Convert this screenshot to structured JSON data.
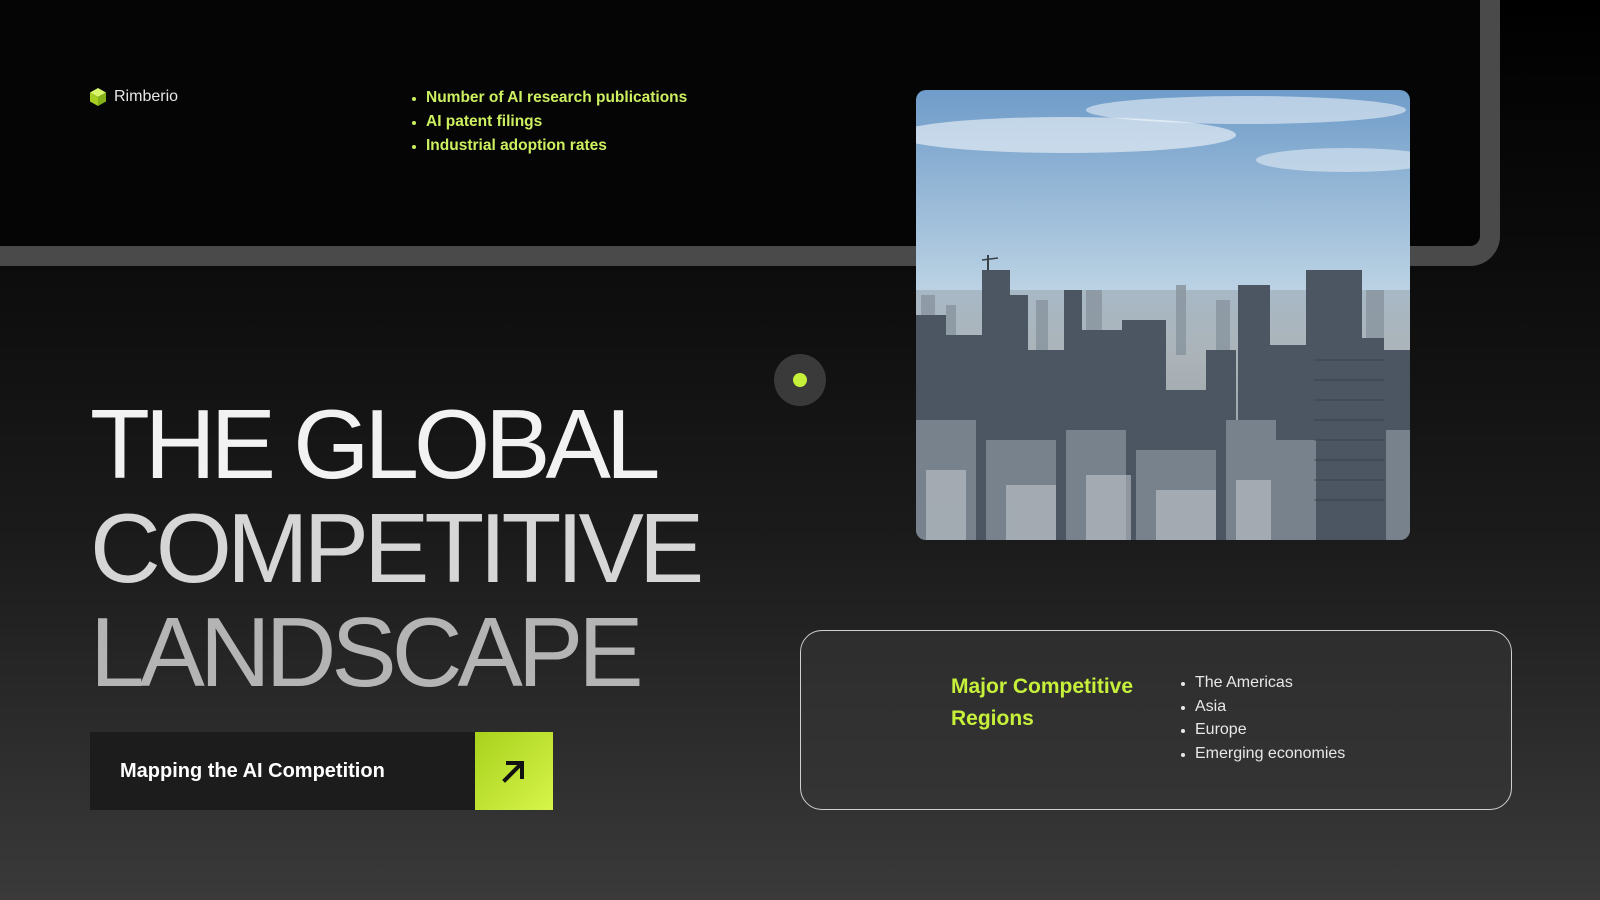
{
  "brand": {
    "name": "Rimberio",
    "icon": "cube-icon",
    "accent": "#c6f03a"
  },
  "metrics": {
    "items": [
      "Number of AI research publications",
      "AI patent filings",
      "Industrial adoption rates"
    ]
  },
  "photo": {
    "subject": "city-skyline-photo"
  },
  "headline": {
    "line1": "THE GLOBAL",
    "line2": "COMPETITIVE",
    "line3": "LANDSCAPE"
  },
  "cta": {
    "label": "Mapping the AI Competition",
    "icon": "arrow-up-right-icon"
  },
  "regions": {
    "title": "Major Competitive Regions",
    "items": [
      "The Americas",
      "Asia",
      "Europe",
      "Emerging economies"
    ]
  }
}
